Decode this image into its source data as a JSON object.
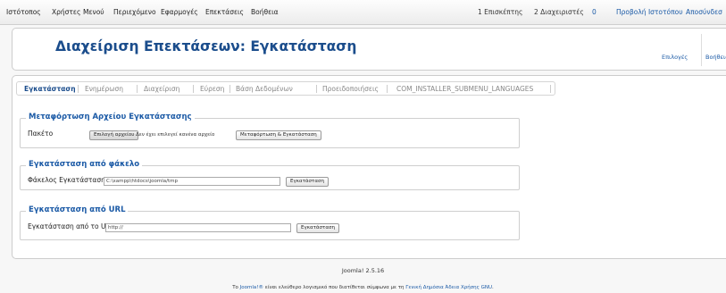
{
  "menu": {
    "items": [
      "Ιστότοπος",
      "Χρήστες",
      "Μενού",
      "Περιεχόμενο",
      "Εφαρμογές",
      "Επεκτάσεις",
      "Βοήθεια"
    ]
  },
  "status": {
    "visitors": "1 Επισκέπτης",
    "admins": "2 Διαχειριστές",
    "messages": "0",
    "view_site": "Προβολή Ιστοτόπου",
    "logout": "Αποσύνδεσ"
  },
  "header": {
    "title": "Διαχείριση Επεκτάσεων: Εγκατάσταση",
    "options": "Επιλογές",
    "help": "Βοήθεια"
  },
  "submenu": {
    "items": [
      "Εγκατάσταση",
      "Ενημέρωση",
      "Διαχείριση",
      "Εύρεση",
      "Βάση Δεδομένων",
      "Προειδοποιήσεις",
      "COM_INSTALLER_SUBMENU_LANGUAGES"
    ],
    "active": "Εγκατάσταση"
  },
  "upload": {
    "legend": "Μεταφόρτωση Αρχείου Εγκατάστασης",
    "label": "Πακέτο",
    "choose_file": "Επιλογή αρχείου",
    "no_file": "Δεν έχει επιλεγεί κανένα αρχείο",
    "submit": "Μεταφόρτωση & Εγκατάσταση"
  },
  "folder": {
    "legend": "Εγκατάσταση από φάκελο",
    "label": "Φάκελος Εγκατάστασης",
    "value": "C:\\xampp\\htdocs\\joomla/tmp",
    "submit": "Εγκατάσταση"
  },
  "url": {
    "legend": "Εγκατάσταση από URL",
    "label": "Εγκατάσταση από το URL",
    "value": "http://",
    "submit": "Εγκατάσταση"
  },
  "footer": {
    "version": "Joomla! 2.5.16",
    "prefix": "Το ",
    "joomla_link": "Joomla!®",
    "middle": " είναι ελεύθερο λογισμικό που διατίθεται σύμφωνα με τη ",
    "license_link": "Γενική Δημόσια Άδεια Χρήσης GNU",
    "suffix": "."
  }
}
